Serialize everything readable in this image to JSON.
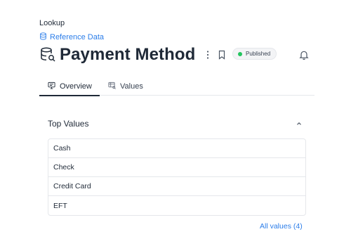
{
  "header": {
    "eyebrow": "Lookup",
    "breadcrumb_label": "Reference Data",
    "title": "Payment Method",
    "status_badge": "Published",
    "status_color": "#22c55e",
    "link_color": "#2b7de9"
  },
  "tabs": [
    {
      "label": "Overview",
      "icon": "preview-icon",
      "active": true
    },
    {
      "label": "Values",
      "icon": "table-search-icon",
      "active": false
    }
  ],
  "top_values": {
    "title": "Top Values",
    "items": [
      "Cash",
      "Check",
      "Credit Card",
      "EFT"
    ],
    "all_values_link": "All values (4)"
  }
}
